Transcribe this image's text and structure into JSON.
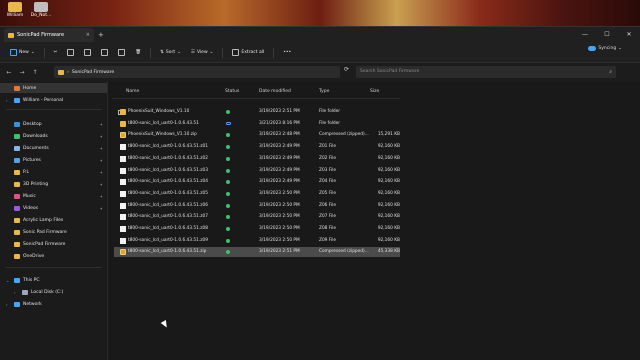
{
  "desktop": {
    "icons": [
      {
        "label": "William",
        "color": "#e8b84a"
      },
      {
        "label": "Do_Not...",
        "color": "#bfbfbf"
      }
    ]
  },
  "window": {
    "tab_title": "SonicPad Firmware",
    "tab_close": "×",
    "new_tab": "+",
    "minimize": "—",
    "maximize": "☐",
    "close": "✕"
  },
  "toolbar": {
    "new_label": "New",
    "sort_label": "Sort",
    "view_label": "View",
    "extract_label": "Extract all",
    "more_label": "•••",
    "sync_label": "Syncing"
  },
  "address": {
    "path": "SonicPad Firmware",
    "search_placeholder": "Search SonicPad Firmware"
  },
  "sidebar": {
    "items": [
      {
        "label": "Home",
        "icon": "home-icon",
        "selected": true
      },
      {
        "label": "William - Personal",
        "icon": "cloud-icon"
      },
      {
        "label": "Desktop",
        "icon": "desktop-icon",
        "pinned": true
      },
      {
        "label": "Downloads",
        "icon": "download-icon",
        "pinned": true
      },
      {
        "label": "Documents",
        "icon": "document-icon",
        "pinned": true
      },
      {
        "label": "Pictures",
        "icon": "pictures-icon",
        "pinned": true
      },
      {
        "label": "P.L",
        "icon": "folder-icon",
        "pinned": true
      },
      {
        "label": "3D Printing",
        "icon": "folder-icon",
        "pinned": true
      },
      {
        "label": "Music",
        "icon": "music-icon",
        "pinned": true
      },
      {
        "label": "Videos",
        "icon": "video-icon",
        "pinned": true
      },
      {
        "label": "Acrylic Lamp Files",
        "icon": "folder-icon"
      },
      {
        "label": "Sonic Pad Firmware",
        "icon": "folder-icon"
      },
      {
        "label": "SonicPad Firmware",
        "icon": "folder-icon"
      },
      {
        "label": "OneDrive",
        "icon": "folder-icon"
      },
      {
        "label": "This PC",
        "icon": "pc-icon"
      },
      {
        "label": "Local Disk (C:)",
        "icon": "disk-icon"
      },
      {
        "label": "Network",
        "icon": "network-icon"
      }
    ]
  },
  "columns": {
    "name": "Name",
    "status": "Status",
    "date": "Date modified",
    "type": "Type",
    "size": "Size"
  },
  "files": [
    {
      "name": "PhoenixSuit_Windows_V1.10",
      "status": "ok",
      "date": "3/19/2023 2:51 PM",
      "type": "File folder",
      "size": "",
      "kind": "folder"
    },
    {
      "name": "t800-sonic_lcd_uart0-1.0.6.43.51",
      "status": "cloud",
      "date": "3/21/2023 8:16 PM",
      "type": "File folder",
      "size": "",
      "kind": "folder"
    },
    {
      "name": "PhoenixSuit_Windows_V1.10.zip",
      "status": "ok",
      "date": "3/19/2023 2:48 PM",
      "type": "Compressed (zipped)...",
      "size": "15,291 KB",
      "kind": "zip"
    },
    {
      "name": "t800-sonic_lcd_uart0-1.0.6.43.51.z01",
      "status": "ok",
      "date": "3/19/2023 2:49 PM",
      "type": "Z01 File",
      "size": "92,160 KB",
      "kind": "doc"
    },
    {
      "name": "t800-sonic_lcd_uart0-1.0.6.43.51.z02",
      "status": "ok",
      "date": "3/19/2023 2:49 PM",
      "type": "Z02 File",
      "size": "92,160 KB",
      "kind": "doc"
    },
    {
      "name": "t800-sonic_lcd_uart0-1.0.6.43.51.z03",
      "status": "ok",
      "date": "3/19/2023 2:49 PM",
      "type": "Z03 File",
      "size": "92,160 KB",
      "kind": "doc"
    },
    {
      "name": "t800-sonic_lcd_uart0-1.0.6.43.51.z04",
      "status": "ok",
      "date": "3/19/2023 2:49 PM",
      "type": "Z04 File",
      "size": "92,160 KB",
      "kind": "doc"
    },
    {
      "name": "t800-sonic_lcd_uart0-1.0.6.43.51.z05",
      "status": "ok",
      "date": "3/19/2023 2:50 PM",
      "type": "Z05 File",
      "size": "92,160 KB",
      "kind": "doc"
    },
    {
      "name": "t800-sonic_lcd_uart0-1.0.6.43.51.z06",
      "status": "ok",
      "date": "3/19/2023 2:50 PM",
      "type": "Z06 File",
      "size": "92,160 KB",
      "kind": "doc"
    },
    {
      "name": "t800-sonic_lcd_uart0-1.0.6.43.51.z07",
      "status": "ok",
      "date": "3/19/2023 2:50 PM",
      "type": "Z07 File",
      "size": "92,160 KB",
      "kind": "doc"
    },
    {
      "name": "t800-sonic_lcd_uart0-1.0.6.43.51.z08",
      "status": "ok",
      "date": "3/19/2023 2:50 PM",
      "type": "Z08 File",
      "size": "92,160 KB",
      "kind": "doc"
    },
    {
      "name": "t800-sonic_lcd_uart0-1.0.6.43.51.z09",
      "status": "ok",
      "date": "3/19/2023 2:50 PM",
      "type": "Z09 File",
      "size": "92,160 KB",
      "kind": "doc"
    },
    {
      "name": "t800-sonic_lcd_uart0-1.0.6.43.51.zip",
      "status": "ok",
      "date": "3/19/2023 2:51 PM",
      "type": "Compressed (zipped)...",
      "size": "45,338 KB",
      "kind": "zip",
      "selected": true
    }
  ]
}
